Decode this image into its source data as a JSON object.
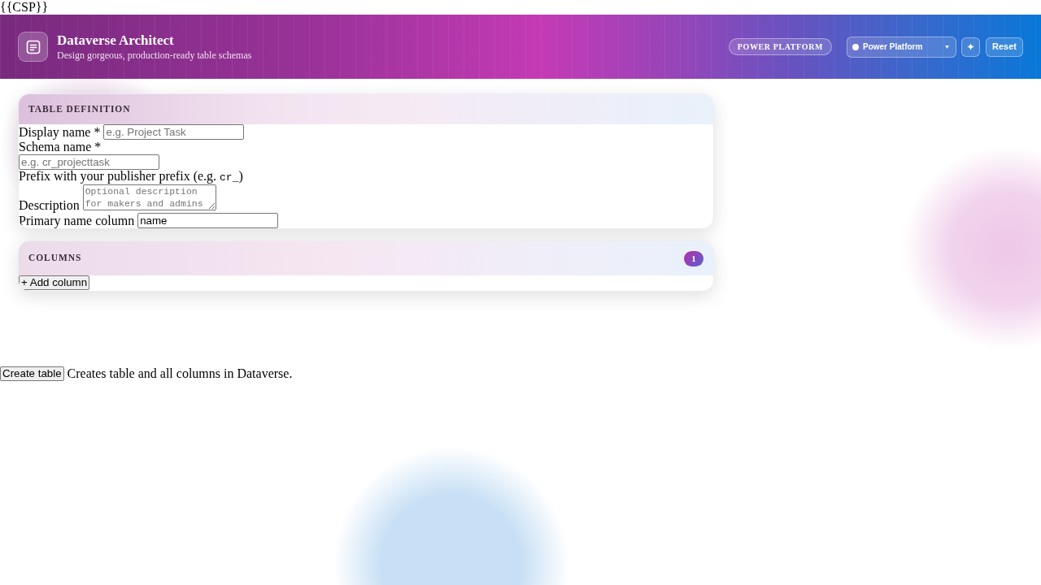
{
  "page_placeholder": "{{CSP}}",
  "header": {
    "title": "Dataverse Architect",
    "subtitle": "Design gorgeous, production-ready table schemas",
    "tag": "POWER PLATFORM",
    "environment_select": {
      "value": "Power Platform"
    },
    "reset_button": "Reset"
  },
  "table_definition": {
    "title": "TABLE DEFINITION",
    "fields": [
      {
        "kind": "inline",
        "label": "Display name *",
        "placeholder": "e.g. Project Task"
      },
      {
        "kind": "stacked",
        "label": "Schema name *",
        "placeholder": "e.g. cr_projecttask"
      },
      {
        "kind": "hint",
        "parts": [
          {
            "kind": "text",
            "text": "Prefix with your publisher prefix (e.g. "
          },
          {
            "kind": "code",
            "text": "cr_"
          },
          {
            "kind": "text",
            "text": ")"
          }
        ]
      },
      {
        "kind": "textarea",
        "label": "Description",
        "placeholder": "Optional description for makers and admins"
      },
      {
        "kind": "inline",
        "label": "Primary name column",
        "value": "name"
      }
    ]
  },
  "columns": {
    "title": "COLUMNS",
    "count": "1",
    "add_button": "+ Add column"
  },
  "footer": {
    "create_button": "Create table",
    "note": "Creates table and all columns in Dataverse."
  }
}
